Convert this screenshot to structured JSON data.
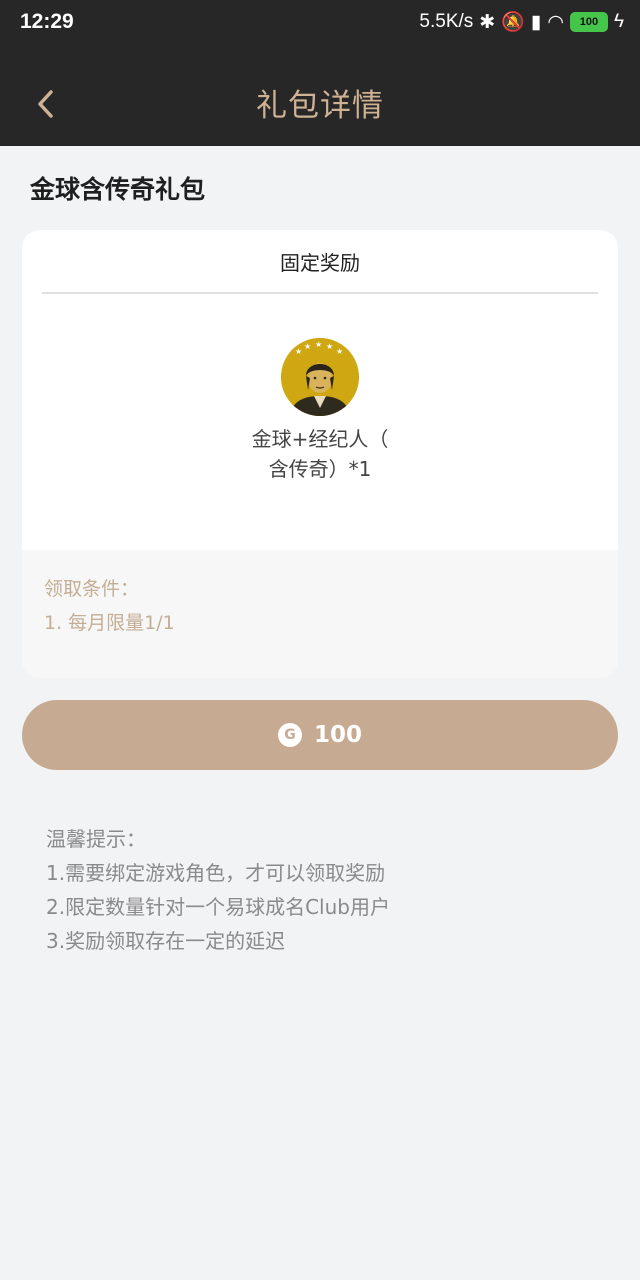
{
  "status_bar": {
    "time": "12:29",
    "net_speed": "5.5K/s",
    "battery": "100"
  },
  "header": {
    "title": "礼包详情"
  },
  "gift": {
    "name": "金球含传奇礼包",
    "section_title": "固定奖励",
    "reward_name_line1": "金球+经纪人（",
    "reward_name_line2": "含传奇）*1",
    "condition_label": "领取条件：",
    "condition_item": "1. 每月限量1/1"
  },
  "claim": {
    "coin_icon_letter": "G",
    "price": "100"
  },
  "tips": {
    "title": "温馨提示：",
    "line1": "1.需要绑定游戏角色，才可以领取奖励",
    "line2": "2.限定数量针对一个易球成名Club用户",
    "line3": "3.奖励领取存在一定的延迟"
  },
  "colors": {
    "accent": "#c7aa92",
    "header_bg": "#272727",
    "title_text": "#cfb294"
  }
}
